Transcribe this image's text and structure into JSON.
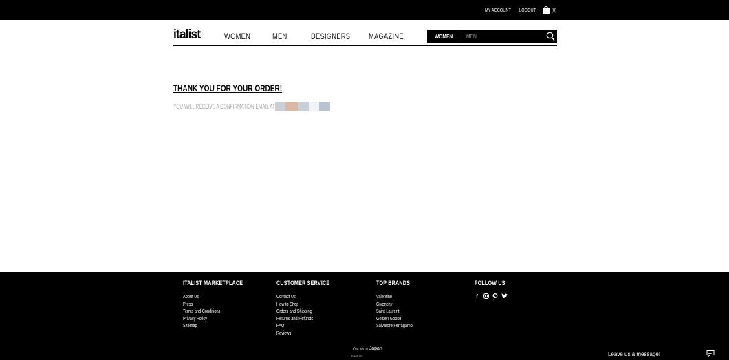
{
  "topbar": {
    "my_account": "MY ACCOUNT",
    "logout": "LOGOUT",
    "cart_count": "(0)"
  },
  "header": {
    "logo": "italist",
    "nav": [
      "WOMEN",
      "MEN",
      "DESIGNERS",
      "MAGAZINE"
    ],
    "search": {
      "segment_active": "WOMEN",
      "segment_other": "MEN"
    }
  },
  "main": {
    "title": "THANK YOU FOR YOUR ORDER!",
    "confirmation_text": "YOU WILL RECEIVE A CONFIRMATION EMAIL AT",
    "redacted_colors": [
      "#c9ced6",
      "#d9b8a4",
      "#c7cfd8",
      "#f0f2f5",
      "#b8c3ce"
    ]
  },
  "footer": {
    "marketplace": {
      "heading": "ITALIST MARKETPLACE",
      "links": [
        "About Us",
        "Press",
        "Terms and Conditions",
        "Privacy Policy",
        "Sitemap"
      ]
    },
    "customer_service": {
      "heading": "CUSTOMER SERVICE",
      "links": [
        "Contact Us",
        "How to Shop",
        "Orders and Shipping",
        "Returns and Refunds",
        "FAQ",
        "Reviews"
      ]
    },
    "top_brands": {
      "heading": "TOP BRANDS",
      "links": [
        "Valentino",
        "Givenchy",
        "Saint Laurent",
        "Golden Goose",
        "Salvatore Ferragamo"
      ]
    },
    "follow_us": {
      "heading": "FOLLOW US",
      "icons": [
        "facebook-icon",
        "instagram-icon",
        "pinterest-icon",
        "twitter-icon"
      ]
    },
    "location_prefix": "You are in",
    "location": "Japan",
    "company": "italist Inc.",
    "chat_label": "Leave us a message!"
  }
}
